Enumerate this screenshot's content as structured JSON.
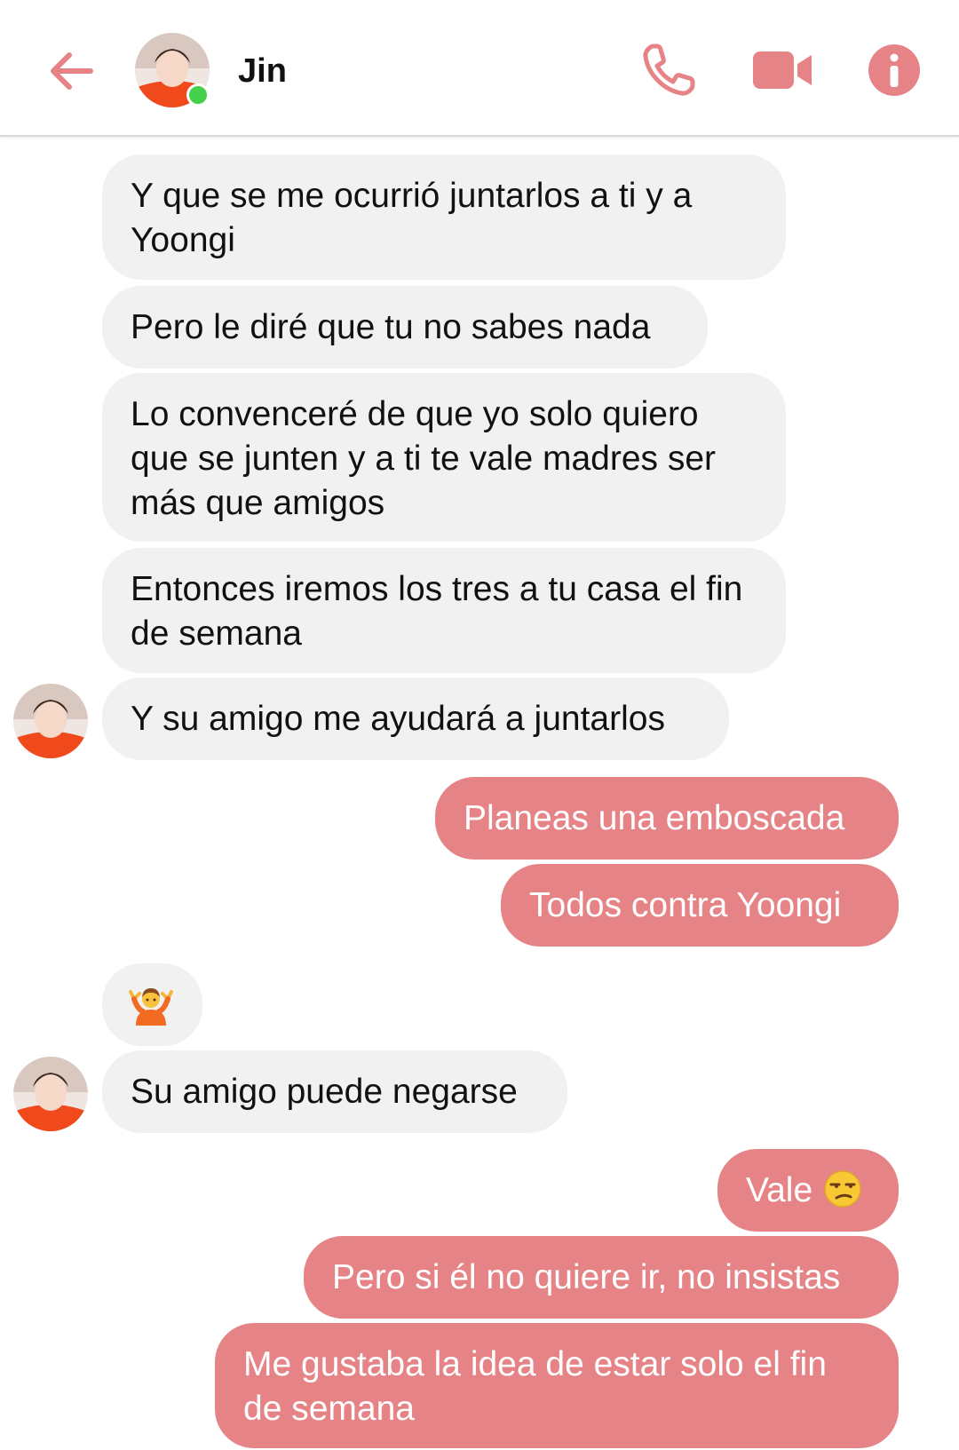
{
  "header": {
    "contact_name": "Jin",
    "icons": [
      "back-arrow-icon",
      "phone-icon",
      "video-camera-icon",
      "info-icon"
    ],
    "presence": "online"
  },
  "colors": {
    "accent": "#e68386",
    "incoming_bubble": "#f1f1f1",
    "online_dot": "#44d04a"
  },
  "messages": [
    {
      "direction": "in",
      "text": "Y que se me ocurrió juntarlos a ti y a Yoongi"
    },
    {
      "direction": "in",
      "text": "Pero le diré que tu no sabes nada"
    },
    {
      "direction": "in",
      "text": "Lo convenceré de que yo solo quiero que se junten y a ti te vale madres ser más que amigos"
    },
    {
      "direction": "in",
      "text": "Entonces iremos los tres a tu casa el fin de semana"
    },
    {
      "direction": "in",
      "text": "Y su amigo me ayudará a juntarlos"
    },
    {
      "direction": "out",
      "text": "Planeas una emboscada"
    },
    {
      "direction": "out",
      "text": "Todos contra Yoongi"
    },
    {
      "direction": "in",
      "emoji": "person-shrugging-emoji"
    },
    {
      "direction": "in",
      "text": "Su amigo puede negarse"
    },
    {
      "direction": "out",
      "text": "Vale",
      "emoji": "unamused-face-emoji"
    },
    {
      "direction": "out",
      "text": "Pero si él no quiere ir, no insistas"
    },
    {
      "direction": "out",
      "text": "Me gustaba la idea de estar solo el fin de semana"
    }
  ]
}
